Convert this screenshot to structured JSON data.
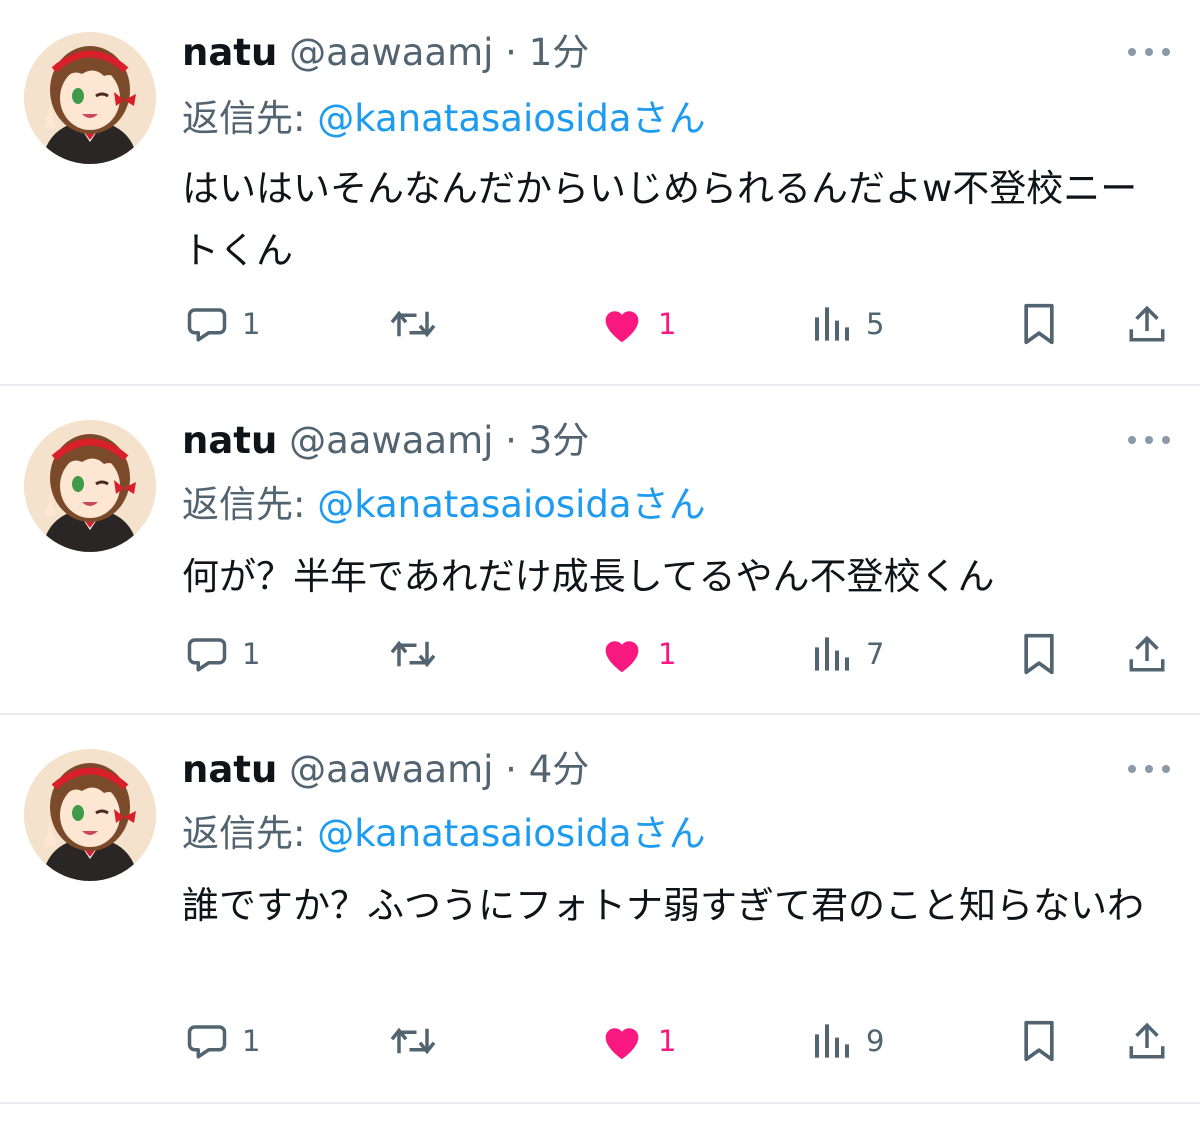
{
  "tweets": [
    {
      "name": "natu",
      "handle": "@aawaamj",
      "separator": "·",
      "time": "1分",
      "reply_label": "返信先: ",
      "reply_mention": "@kanatasaiosida",
      "reply_suffix": "さん",
      "text": "はいはいそんなんだからいじめられるんだよw不登校ニートくん",
      "replies": "1",
      "likes": "1",
      "views": "5"
    },
    {
      "name": "natu",
      "handle": "@aawaamj",
      "separator": "·",
      "time": "3分",
      "reply_label": "返信先: ",
      "reply_mention": "@kanatasaiosida",
      "reply_suffix": "さん",
      "text": "何が？半年であれだけ成長してるやん不登校くん",
      "replies": "1",
      "likes": "1",
      "views": "7"
    },
    {
      "name": "natu",
      "handle": "@aawaamj",
      "separator": "·",
      "time": "4分",
      "reply_label": "返信先: ",
      "reply_mention": "@kanatasaiosida",
      "reply_suffix": "さん",
      "text": "誰ですか？ふつうにフォトナ弱すぎて君のこと知らないわ",
      "replies": "1",
      "likes": "1",
      "views": "9"
    }
  ],
  "icons": {
    "reply": "speech-bubble-icon",
    "retweet": "retweet-arrows-icon",
    "like": "heart-icon",
    "views": "bar-chart-icon",
    "bookmark": "bookmark-icon",
    "share": "share-upload-icon",
    "more": "ellipsis-icon"
  },
  "colors": {
    "accent": "#1d9bf0",
    "like": "#f91880",
    "secondary_text": "#536471",
    "divider": "#e6ecf0"
  }
}
